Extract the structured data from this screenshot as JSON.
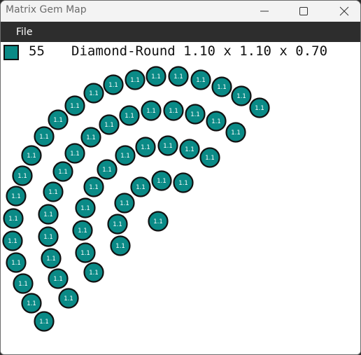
{
  "window": {
    "title": "Matrix Gem Map",
    "menu": [
      "File"
    ]
  },
  "info": {
    "swatch_color": "#0a8a86",
    "count": "55",
    "spec": "Diamond-Round 1.10 x 1.10 x 0.70"
  },
  "gem": {
    "label": "1.1",
    "fill": "#0a8a86",
    "stroke": "#111111"
  },
  "icons": [
    "minimize-icon",
    "maximize-icon",
    "close-icon"
  ]
}
